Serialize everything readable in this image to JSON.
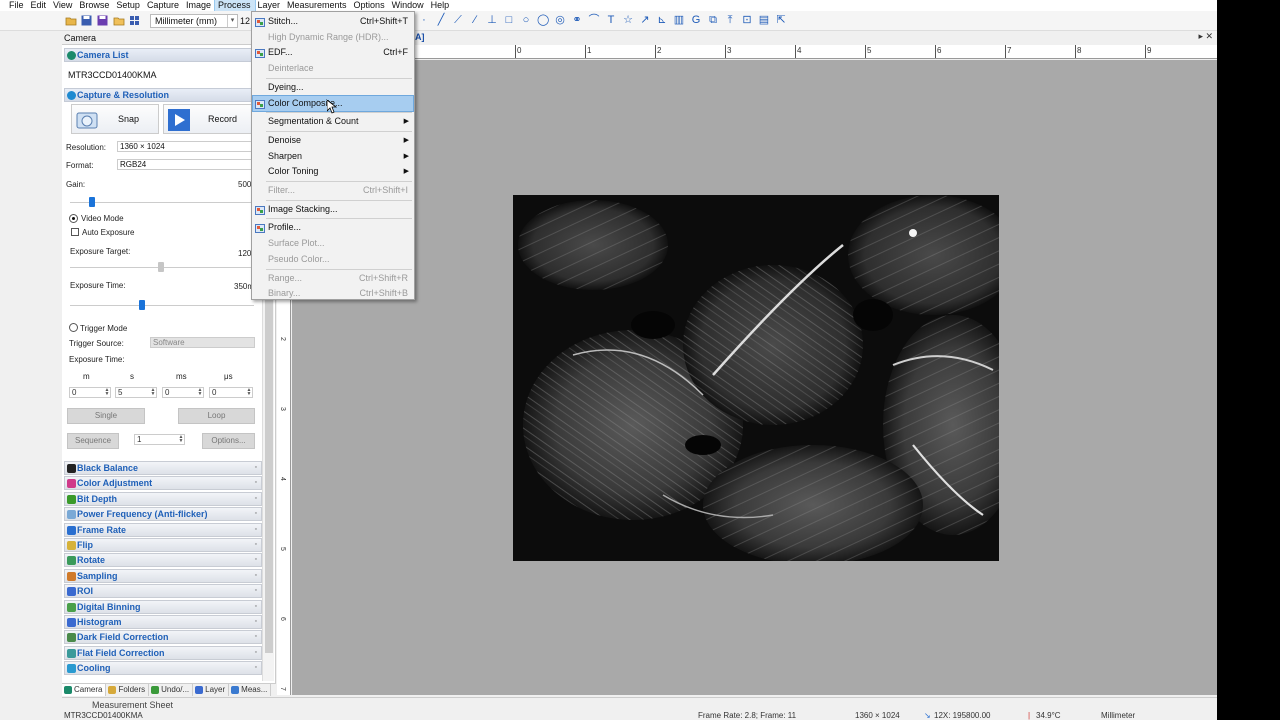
{
  "menubar": {
    "items": [
      "File",
      "Edit",
      "View",
      "Browse",
      "Setup",
      "Capture",
      "Image",
      "Process",
      "Layer",
      "Measurements",
      "Options",
      "Window",
      "Help"
    ]
  },
  "toolbar": {
    "unit": "Millimeter (mm)",
    "zoom": "12"
  },
  "panel": {
    "title": "Camera",
    "camera_list_header": "Camera List",
    "camera_name": "MTR3CCD01400KMA",
    "capture_header": "Capture & Resolution",
    "snap_label": "Snap",
    "record_label": "Record",
    "resolution_label": "Resolution:",
    "resolution_value": "1360 × 1024",
    "format_label": "Format:",
    "format_value": "RGB24",
    "gain_label": "Gain:",
    "gain_value": "500",
    "gain_level": 0.12,
    "video_mode_label": "Video Mode",
    "auto_exposure_label": "Auto Exposure",
    "exposure_target_label": "Exposure Target:",
    "exposure_target_value": "120",
    "exposure_time_label": "Exposure Time:",
    "exposure_time_value": "350m",
    "trigger_mode_label": "Trigger Mode",
    "trigger_source_label": "Trigger Source:",
    "trigger_source_value": "Software",
    "trigger_exposure_label": "Exposure Time:",
    "unit_m": "m",
    "unit_s": "s",
    "unit_ms": "ms",
    "unit_us": "μs",
    "spin_m": "0",
    "spin_s": "5",
    "spin_ms": "0",
    "spin_us": "0",
    "single_label": "Single",
    "loop_label": "Loop",
    "sequence_label": "Sequence",
    "sequence_value": "1",
    "options_label": "Options...",
    "sections": [
      {
        "label": "Black Balance",
        "color": "#222222"
      },
      {
        "label": "Color Adjustment",
        "color": "#d03a8a"
      },
      {
        "label": "Bit Depth",
        "color": "#3a9a2a"
      },
      {
        "label": "Power Frequency (Anti-flicker)",
        "color": "#7aa9d6"
      },
      {
        "label": "Frame Rate",
        "color": "#2a6fd0"
      },
      {
        "label": "Flip",
        "color": "#d6b23a"
      },
      {
        "label": "Rotate",
        "color": "#3a9a5a"
      },
      {
        "label": "Sampling",
        "color": "#d07a2a"
      },
      {
        "label": "ROI",
        "color": "#3a6ad0"
      },
      {
        "label": "Digital Binning",
        "color": "#4aa04a"
      },
      {
        "label": "Histogram",
        "color": "#3a6ad0"
      },
      {
        "label": "Dark Field Correction",
        "color": "#4a8a4a"
      },
      {
        "label": "Flat Field Correction",
        "color": "#3a9a9a"
      },
      {
        "label": "Cooling",
        "color": "#2a9ad0"
      }
    ]
  },
  "bottom_tabs": [
    {
      "label": "Camera",
      "color": "#1b8a6a"
    },
    {
      "label": "Folders",
      "color": "#d6a93a"
    },
    {
      "label": "Undo/...",
      "color": "#3a9a3a"
    },
    {
      "label": "Layer",
      "color": "#3a6ad0"
    },
    {
      "label": "Meas...",
      "color": "#3a7ad0"
    }
  ],
  "doc_tab": "A]",
  "hruler_labels": [
    "0",
    "1",
    "2",
    "3",
    "4",
    "5",
    "6",
    "7",
    "8",
    "9"
  ],
  "vruler_labels": [
    "2",
    "3",
    "4",
    "5",
    "6",
    "7"
  ],
  "measurement_sheet": "Measurement Sheet",
  "status": {
    "camera": "MTR3CCD01400KMA",
    "frame": "Frame Rate: 2.8; Frame: 11",
    "resolution": "1360 × 1024",
    "scale": "12X: 195800.00",
    "temperature": "34.9°C",
    "unit": "Millimeter"
  },
  "process_menu": [
    {
      "label": "Stitch...",
      "shortcut": "Ctrl+Shift+T",
      "disabled": false,
      "icon": "stitch-icon"
    },
    {
      "label": "High Dynamic Range (HDR)...",
      "shortcut": "",
      "disabled": true,
      "icon": ""
    },
    {
      "label": "EDF...",
      "shortcut": "Ctrl+F",
      "disabled": false,
      "icon": "edf-icon"
    },
    {
      "label": "Deinterlace",
      "shortcut": "",
      "disabled": true,
      "icon": ""
    },
    {
      "sep": true
    },
    {
      "label": "Dyeing...",
      "shortcut": "",
      "disabled": false,
      "icon": ""
    },
    {
      "label": "Color Composite...",
      "shortcut": "",
      "disabled": false,
      "icon": "color-composite-icon",
      "highlight": true
    },
    {
      "sep": true
    },
    {
      "label": "Segmentation & Count",
      "submenu": true,
      "disabled": false
    },
    {
      "sep": true
    },
    {
      "label": "Denoise",
      "submenu": true,
      "disabled": false
    },
    {
      "label": "Sharpen",
      "submenu": true,
      "disabled": false
    },
    {
      "label": "Color Toning",
      "submenu": true,
      "disabled": false
    },
    {
      "sep": true
    },
    {
      "label": "Filter...",
      "shortcut": "Ctrl+Shift+I",
      "disabled": true,
      "icon": ""
    },
    {
      "sep": true
    },
    {
      "label": "Image Stacking...",
      "shortcut": "",
      "disabled": false,
      "icon": "image-stacking-icon"
    },
    {
      "sep": true
    },
    {
      "label": "Profile...",
      "shortcut": "",
      "disabled": false,
      "icon": "profile-icon"
    },
    {
      "label": "Surface Plot...",
      "shortcut": "",
      "disabled": true,
      "icon": ""
    },
    {
      "label": "Pseudo Color...",
      "shortcut": "",
      "disabled": true,
      "icon": ""
    },
    {
      "sep": true
    },
    {
      "label": "Range...",
      "shortcut": "Ctrl+Shift+R",
      "disabled": true,
      "icon": ""
    },
    {
      "label": "Binary...",
      "shortcut": "Ctrl+Shift+B",
      "disabled": true,
      "icon": ""
    }
  ]
}
